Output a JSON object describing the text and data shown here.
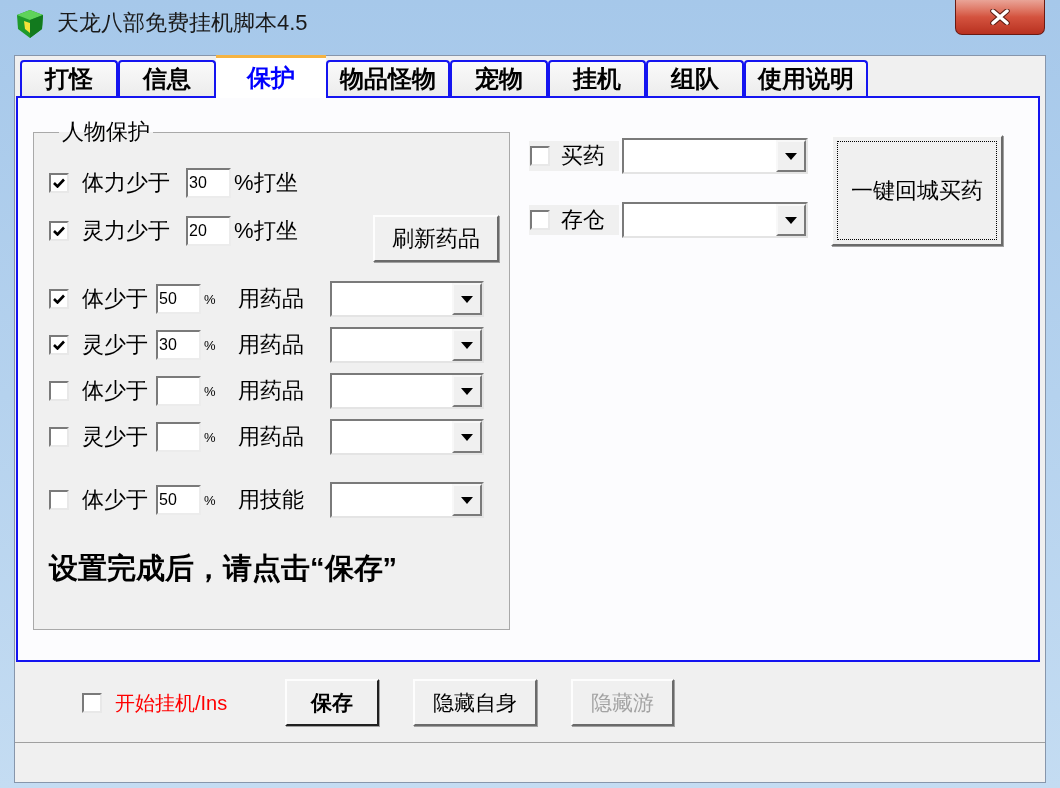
{
  "window": {
    "title": "天龙八部免费挂机脚本4.5"
  },
  "tabs": [
    {
      "label": "打怪",
      "selected": false
    },
    {
      "label": "信息",
      "selected": false
    },
    {
      "label": "保护",
      "selected": true
    },
    {
      "label": "物品怪物",
      "selected": false
    },
    {
      "label": "宠物",
      "selected": false
    },
    {
      "label": "挂机",
      "selected": false
    },
    {
      "label": "组队",
      "selected": false
    },
    {
      "label": "使用说明",
      "selected": false
    }
  ],
  "protection": {
    "title": "人物保护",
    "rows": [
      {
        "kind": "sit",
        "checked": true,
        "label": "体力少于",
        "value": "30",
        "suffix": "%打坐"
      },
      {
        "kind": "sit",
        "checked": true,
        "label": "灵力少于",
        "value": "20",
        "suffix": "%打坐"
      },
      {
        "kind": "use",
        "checked": true,
        "label": "体少于",
        "value": "50",
        "unit": "%",
        "action": "用药品"
      },
      {
        "kind": "use",
        "checked": true,
        "label": "灵少于",
        "value": "30",
        "unit": "%",
        "action": "用药品"
      },
      {
        "kind": "use",
        "checked": false,
        "label": "体少于",
        "unit": "%",
        "action": "用药品"
      },
      {
        "kind": "use",
        "checked": false,
        "label": "灵少于",
        "unit": "%",
        "action": "用药品"
      },
      {
        "kind": "skill",
        "checked": false,
        "label": "体少于",
        "value": "50",
        "unit": "%",
        "action": "用技能"
      }
    ],
    "refresh_button": {
      "label": "刷新药品"
    },
    "note": "设置完成后，请点击“保存”"
  },
  "town": {
    "options": [
      {
        "checked": false,
        "label": "买药"
      },
      {
        "checked": false,
        "label": "存仓"
      }
    ],
    "button": {
      "label": "一键回城买药",
      "focused": true
    }
  },
  "footer": {
    "start": {
      "checked": false,
      "label": "开始挂机/Ins"
    },
    "buttons": [
      {
        "label": "保存",
        "default": true,
        "disabled": false
      },
      {
        "label": "隐藏自身",
        "default": false,
        "disabled": false
      },
      {
        "label": "隐藏游",
        "default": false,
        "disabled": true
      }
    ]
  }
}
